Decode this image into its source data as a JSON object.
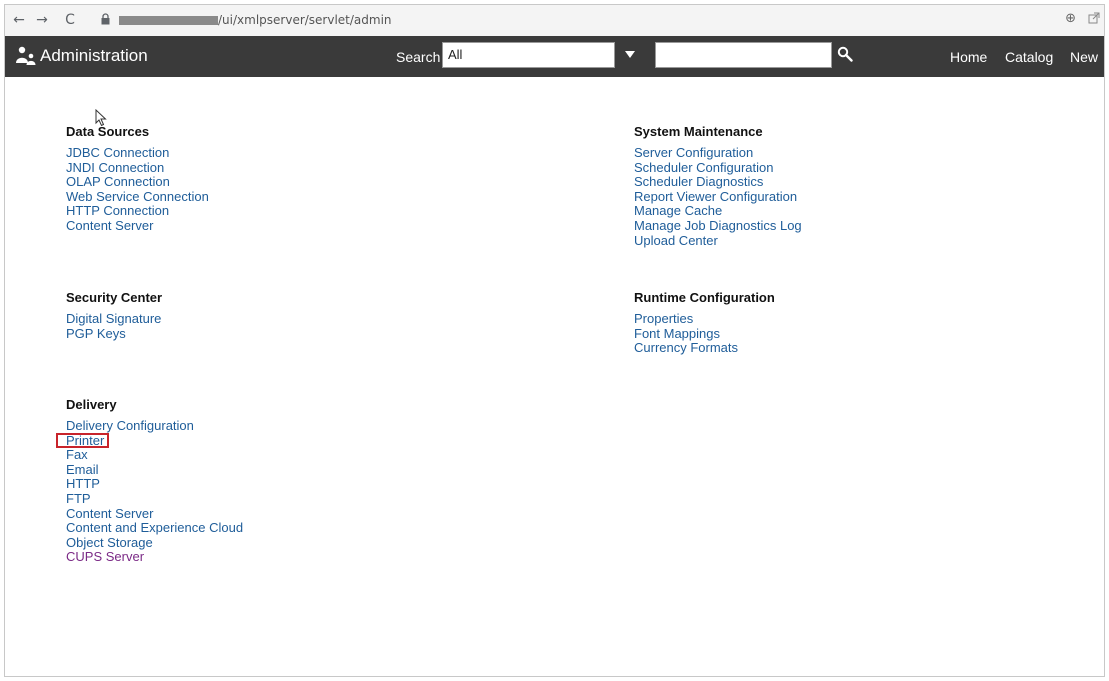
{
  "browser": {
    "url_path": "/ui/xmlpserver/servlet/admin",
    "back_glyph": "←",
    "forward_glyph": "→",
    "reload_glyph": "C",
    "zoom_glyph": "⊕"
  },
  "header": {
    "title": "Administration",
    "search_label": "Search",
    "search_scope": "All",
    "search_value": "",
    "nav": [
      "Home",
      "Catalog",
      "New"
    ]
  },
  "sections": {
    "data_sources": {
      "title": "Data Sources",
      "links": [
        "JDBC Connection",
        "JNDI Connection",
        "OLAP Connection",
        "Web Service Connection",
        "HTTP Connection",
        "Content Server"
      ]
    },
    "system_maintenance": {
      "title": "System Maintenance",
      "links": [
        "Server Configuration",
        "Scheduler Configuration",
        "Scheduler Diagnostics",
        "Report Viewer Configuration",
        "Manage Cache",
        "Manage Job Diagnostics Log",
        "Upload Center"
      ]
    },
    "security_center": {
      "title": "Security Center",
      "links": [
        "Digital Signature",
        "PGP Keys"
      ]
    },
    "runtime_configuration": {
      "title": "Runtime Configuration",
      "links": [
        "Properties",
        "Font Mappings",
        "Currency Formats"
      ]
    },
    "delivery": {
      "title": "Delivery",
      "links": [
        "Delivery Configuration",
        "Printer",
        "Fax",
        "Email",
        "HTTP",
        "FTP",
        "Content Server",
        "Content and Experience Cloud",
        "Object Storage",
        "CUPS Server"
      ]
    }
  },
  "colors": {
    "link": "#1f5d99",
    "visited_link": "#7b2a86",
    "header_bg": "#3a3a3a",
    "highlight_box": "#c8242b"
  }
}
